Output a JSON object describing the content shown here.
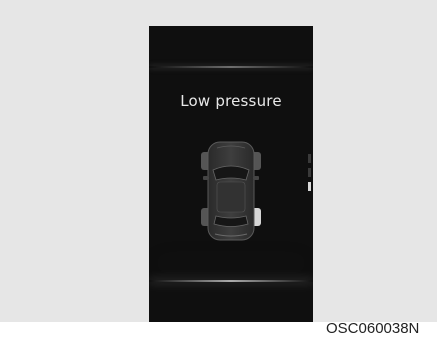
{
  "screen": {
    "message": "Low pressure",
    "figure_code": "OSC060038N"
  },
  "vehicle": {
    "icon": "car-top-view-icon",
    "tire_highlight": "rear-right"
  },
  "scroll_indicator": {
    "pages": 3,
    "active": 3
  }
}
